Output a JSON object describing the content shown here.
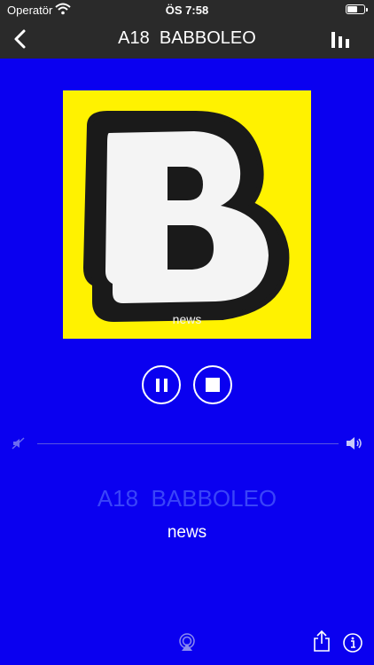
{
  "status_bar": {
    "carrier": "Operatör",
    "time": "ÖS 7:58",
    "battery_level": 0.6
  },
  "nav": {
    "title": "A18  BABBOLEO",
    "back_icon": "chevron-left-icon",
    "equalizer_icon": "equalizer-icon"
  },
  "artwork": {
    "logo_letter": "B",
    "caption": "news",
    "background_color": "#fff200"
  },
  "playback": {
    "pause_icon": "pause-icon",
    "stop_icon": "stop-icon"
  },
  "volume": {
    "low_icon": "volume-low-icon",
    "high_icon": "volume-high-icon"
  },
  "station": {
    "name": "A18  BABBOLEO",
    "genre": "news"
  },
  "toolbar": {
    "airplay_icon": "airplay-icon",
    "share_icon": "share-icon",
    "info_icon": "info-icon"
  },
  "colors": {
    "background": "#0a00f0",
    "bar": "#2a2a2a",
    "station_name": "#3a44f8"
  }
}
